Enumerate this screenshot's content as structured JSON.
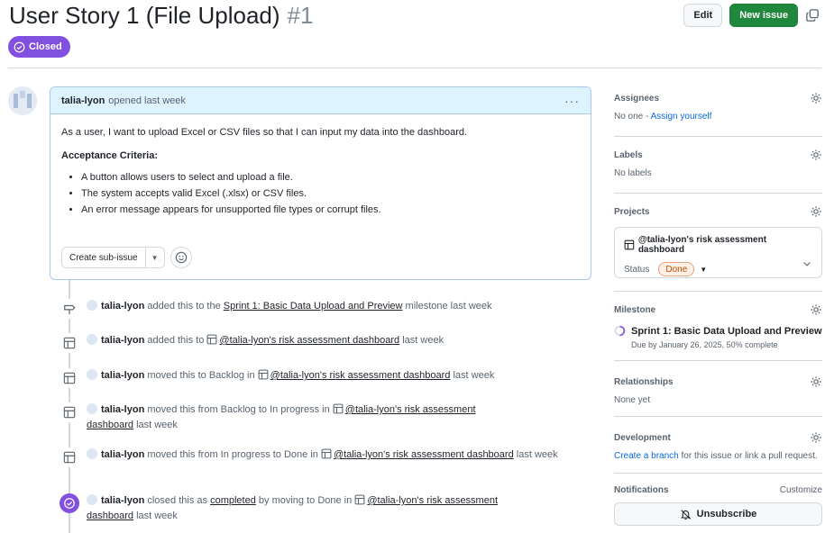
{
  "issue": {
    "title": "User Story 1 (File Upload)",
    "number": "#1",
    "state": "Closed"
  },
  "header": {
    "edit_label": "Edit",
    "new_issue_label": "New issue"
  },
  "comment": {
    "author": "talia-lyon",
    "meta": "opened last week",
    "body_intro": "As a user, I want to upload Excel or CSV files so that I can input my data into the dashboard.",
    "criteria_heading": "Acceptance Criteria:",
    "criteria": [
      "A button allows users to select and upload a file.",
      "The system accepts valid Excel (.xlsx) or CSV files.",
      "An error message appears for unsupported file types or corrupt files."
    ],
    "sub_issue_label": "Create sub-issue"
  },
  "timeline": [
    {
      "actor": "talia-lyon",
      "pre": "added this to the",
      "link": "Sprint 1: Basic Data Upload and Preview",
      "post": "milestone last week"
    },
    {
      "actor": "talia-lyon",
      "pre": "added this to",
      "link": "@talia-lyon's risk assessment dashboard",
      "post": "last week"
    },
    {
      "actor": "talia-lyon",
      "pre": "moved this to Backlog in",
      "link": "@talia-lyon's risk assessment dashboard",
      "post": "last week"
    },
    {
      "actor": "talia-lyon",
      "pre": "moved this from Backlog to In progress in",
      "link": "@talia-lyon's risk assessment dashboard",
      "post": "last week"
    },
    {
      "actor": "talia-lyon",
      "pre": "moved this from In progress to Done in",
      "link": "@talia-lyon's risk assessment dashboard",
      "post": "last week"
    },
    {
      "actor": "talia-lyon",
      "pre": "closed this as",
      "link_a": "completed",
      "mid": "by moving to Done in",
      "link": "@talia-lyon's risk assessment dashboard",
      "post": "last week"
    }
  ],
  "sidebar": {
    "assignees": {
      "title": "Assignees",
      "value": "No one - ",
      "action": "Assign yourself"
    },
    "labels": {
      "title": "Labels",
      "value": "No labels"
    },
    "projects": {
      "title": "Projects",
      "project_name": "@talia-lyon's risk assessment dashboard",
      "status_label": "Status",
      "status_value": "Done"
    },
    "milestone": {
      "title": "Milestone",
      "name": "Sprint 1: Basic Data Upload and Preview",
      "meta": "Due by January 26, 2025, 50% complete"
    },
    "relationships": {
      "title": "Relationships",
      "value": "None yet"
    },
    "development": {
      "title": "Development",
      "link": "Create a branch",
      "value": " for this issue or link a pull request."
    },
    "notifications": {
      "title": "Notifications",
      "customize": "Customize",
      "unsubscribe": "Unsubscribe"
    }
  },
  "colors": {
    "closed_purple": "#8250df",
    "primary_green": "#1f883d",
    "link_blue": "#0969da",
    "done_orange": "#bc4c00"
  }
}
